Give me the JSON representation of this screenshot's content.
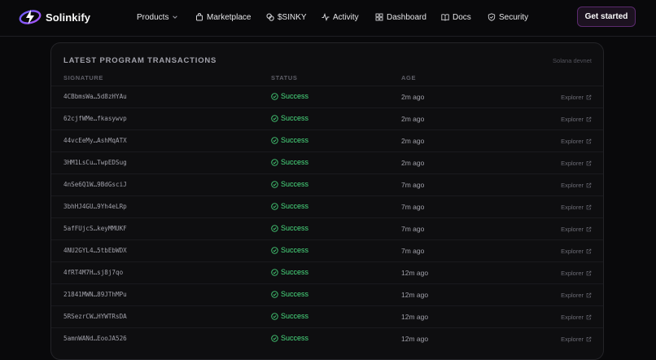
{
  "brand": {
    "name": "Solinkify"
  },
  "nav": {
    "products": "Products",
    "marketplace": "Marketplace",
    "token": "$SINKY",
    "activity": "Activity",
    "dashboard": "Dashboard",
    "docs": "Docs",
    "security": "Security",
    "cta": "Get started"
  },
  "panel": {
    "title": "LATEST PROGRAM TRANSACTIONS",
    "network": "Solana devnet",
    "columns": {
      "signature": "SIGNATURE",
      "status": "STATUS",
      "age": "AGE"
    },
    "link_label": "Explorer",
    "rows": [
      {
        "signature": "4CBbmsWa…5d8zHYAu",
        "status": "Success",
        "age": "2m ago"
      },
      {
        "signature": "62cjfWMe…fkasywvp",
        "status": "Success",
        "age": "2m ago"
      },
      {
        "signature": "44vcEeMy…AshMqATX",
        "status": "Success",
        "age": "2m ago"
      },
      {
        "signature": "3HM1LsCu…TwpEDSug",
        "status": "Success",
        "age": "2m ago"
      },
      {
        "signature": "4nSe6Q1W…9BdGsciJ",
        "status": "Success",
        "age": "7m ago"
      },
      {
        "signature": "3bhHJ4GU…9Yh4eLRp",
        "status": "Success",
        "age": "7m ago"
      },
      {
        "signature": "5afFUjcS…keyMMUKF",
        "status": "Success",
        "age": "7m ago"
      },
      {
        "signature": "4NU2GYL4…5tbEbWDX",
        "status": "Success",
        "age": "7m ago"
      },
      {
        "signature": "4fRT4M7H…sj8j7qo",
        "status": "Success",
        "age": "12m ago"
      },
      {
        "signature": "21841MWN…89JThMPu",
        "status": "Success",
        "age": "12m ago"
      },
      {
        "signature": "5RSezrCW…HYWTRsDA",
        "status": "Success",
        "age": "12m ago"
      },
      {
        "signature": "5amnWANd…EooJA526",
        "status": "Success",
        "age": "12m ago"
      }
    ]
  },
  "colors": {
    "success": "#4ade80",
    "accent": "#7c3aed",
    "cta_border": "#5b2a6e"
  }
}
